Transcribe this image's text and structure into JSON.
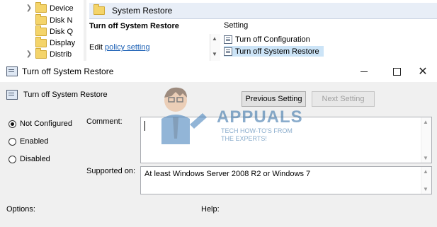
{
  "tree": {
    "items": [
      {
        "label": "Device"
      },
      {
        "label": "Disk N"
      },
      {
        "label": "Disk Q"
      },
      {
        "label": "Display"
      },
      {
        "label": "Distrib"
      }
    ]
  },
  "right_pane": {
    "header_title": "System Restore",
    "policy_title": "Turn off System Restore",
    "edit_prefix": "Edit ",
    "edit_link": "policy setting",
    "list_header": "Setting",
    "list_items": [
      {
        "label": "Turn off Configuration",
        "selected": false
      },
      {
        "label": "Turn off System Restore",
        "selected": true
      }
    ]
  },
  "dialog": {
    "window_title": "Turn off System Restore",
    "policy_name": "Turn off System Restore",
    "prev_button": "Previous Setting",
    "next_button": "Next Setting",
    "radios": [
      {
        "label": "Not Configured",
        "checked": true
      },
      {
        "label": "Enabled",
        "checked": false
      },
      {
        "label": "Disabled",
        "checked": false
      }
    ],
    "comment_label": "Comment:",
    "comment_value": "",
    "supported_label": "Supported on:",
    "supported_value": "At least Windows Server 2008 R2 or Windows 7",
    "options_label": "Options:",
    "help_label": "Help:"
  },
  "watermark": {
    "brand": "APPUALS",
    "tagline_1": "TECH HOW-TO'S FROM",
    "tagline_2": "THE EXPERTS!"
  },
  "colors": {
    "link": "#1a5fb4",
    "selection": "#cce4f7",
    "watermark": "#2b6aa3"
  }
}
